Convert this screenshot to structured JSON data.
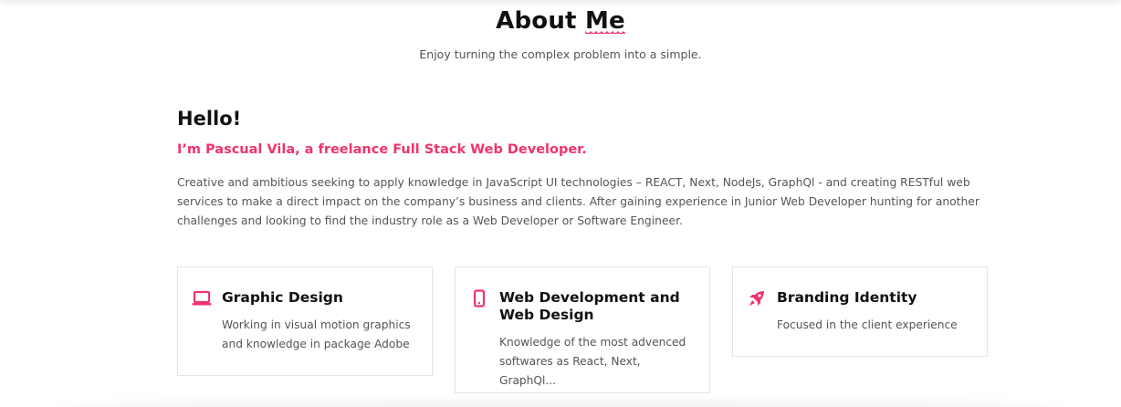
{
  "section": {
    "title_part1": "About ",
    "title_highlight": "Me",
    "subtitle": "Enjoy turning the complex problem into a simple."
  },
  "about": {
    "greeting": "Hello!",
    "intro": "I’m Pascual Vila, a freelance Full Stack Web Developer.",
    "bio": "Creative and ambitious seeking to apply knowledge in JavaScript UI technologies – REACT, Next, NodeJs, GraphQl - and creating RESTful web services to make a direct impact on the company’s business and clients. After gaining experience in Junior Web Developer hunting for another challenges and looking to find the industry role as a Web Developer or Software Engineer."
  },
  "services": [
    {
      "icon": "laptop-icon",
      "title": "Graphic Design",
      "description": "Working in visual motion graphics and knowledge in package Adobe"
    },
    {
      "icon": "mobile-icon",
      "title": "Web Development and Web Design",
      "description": "Knowledge of the most advenced softwares as React, Next, GraphQl..."
    },
    {
      "icon": "rocket-icon",
      "title": "Branding Identity",
      "description": "Focused in the client experience"
    }
  ],
  "colors": {
    "accent": "#f0336c",
    "heading": "#111111",
    "body_text": "#555555",
    "card_border": "#e5e5e5"
  }
}
